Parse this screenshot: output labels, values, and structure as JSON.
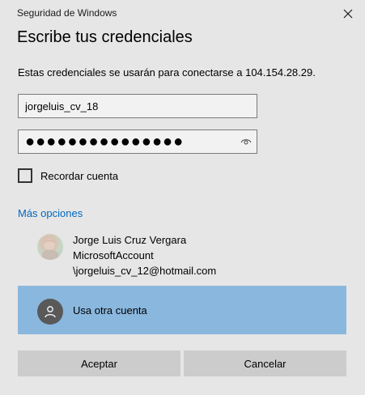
{
  "window": {
    "title": "Seguridad de Windows"
  },
  "dialog": {
    "heading": "Escribe tus credenciales",
    "message": "Estas credenciales se usarán para conectarse a 104.154.28.29."
  },
  "username": {
    "value": "jorgeluis_cv_18"
  },
  "password": {
    "masked_value": "●●●●●●●●●●●●●●●"
  },
  "remember": {
    "label": "Recordar cuenta",
    "checked": false
  },
  "more_options": {
    "label": "Más opciones"
  },
  "accounts": [
    {
      "name": "Jorge Luis Cruz Vergara",
      "type": "MicrosoftAccount",
      "email": "\\jorgeluis_cv_12@hotmail.com"
    },
    {
      "name": "Usa otra cuenta",
      "selected": true
    }
  ],
  "buttons": {
    "ok": "Aceptar",
    "cancel": "Cancelar"
  },
  "colors": {
    "background": "#e6e6e6",
    "link": "#0067c0",
    "selected_account": "#8ab7de",
    "button": "#cccccc"
  },
  "icons": {
    "close": "close-icon",
    "reveal_password": "eye-icon",
    "generic_user": "person-icon"
  }
}
